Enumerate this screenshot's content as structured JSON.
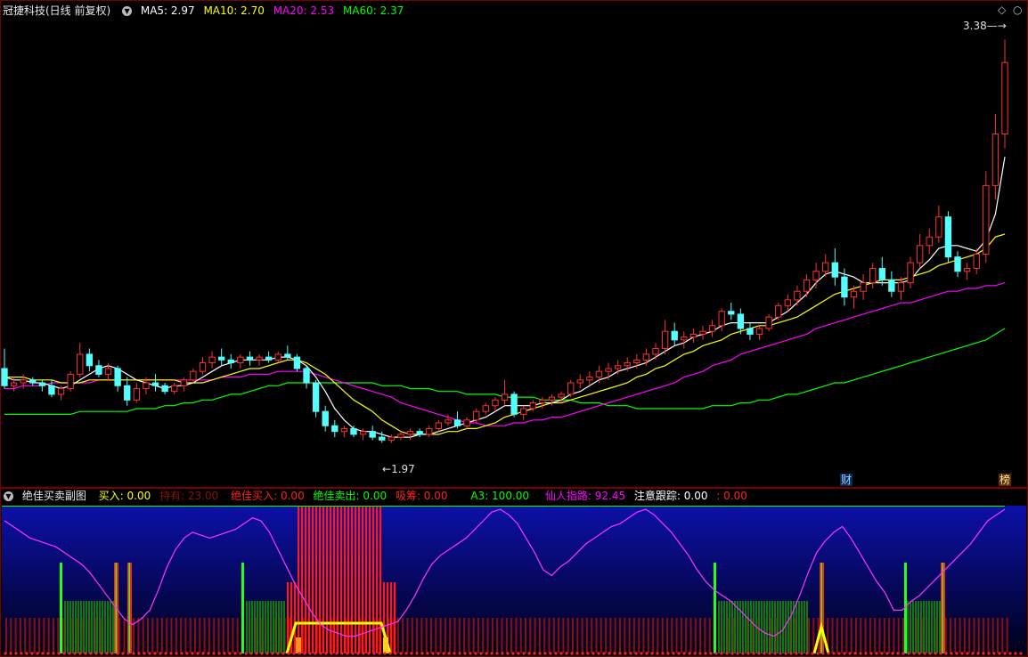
{
  "main": {
    "title": "冠捷科技(日线 前复权)",
    "ma": [
      {
        "label": "MA5: 2.97",
        "color": "#ffffff"
      },
      {
        "label": "MA10: 2.70",
        "color": "#ffff00"
      },
      {
        "label": "MA20: 2.53",
        "color": "#ff00ff"
      },
      {
        "label": "MA60: 2.37",
        "color": "#00ff00"
      }
    ],
    "high_label": "3.38",
    "low_label": "1.97",
    "tag_cai": "财",
    "tag_bang": "榜",
    "diamond": "◇"
  },
  "sub": {
    "title": "绝佳买卖副图",
    "items": [
      {
        "label": "买入: 0.00",
        "color": "#ffff00"
      },
      {
        "label": "持有: 23.00",
        "color": "#8a1010"
      },
      {
        "label": "绝佳买入: 0.00",
        "color": "#ff2020"
      },
      {
        "label": "绝佳卖出: 0.00",
        "color": "#00ff00"
      },
      {
        "label": "吸筹: 0.00",
        "color": "#ff2020"
      },
      {
        "label": "A3: 100.00",
        "color": "#00ff00"
      },
      {
        "label": "仙人指路: 92.45",
        "color": "#ff00ff"
      },
      {
        "label": "注意跟踪: 0.00",
        "color": "#ffffff"
      },
      {
        "label": ": 0.00",
        "color": "#ff2020"
      }
    ]
  },
  "chart_data": [
    {
      "type": "candlestick",
      "title": "冠捷科技(日线 前复权)",
      "ylim": [
        1.9,
        3.45
      ],
      "colors": {
        "up": "#ff3030",
        "down": "#54ffff",
        "ma5": "#ffffff",
        "ma10": "#ffff00",
        "ma20": "#ff00ff",
        "ma60": "#00ff00"
      },
      "candles": [
        [
          2.23,
          2.3,
          2.16,
          2.17
        ],
        [
          2.17,
          2.2,
          2.15,
          2.18
        ],
        [
          2.18,
          2.21,
          2.16,
          2.19
        ],
        [
          2.19,
          2.2,
          2.17,
          2.18
        ],
        [
          2.18,
          2.19,
          2.15,
          2.17
        ],
        [
          2.17,
          2.19,
          2.13,
          2.14
        ],
        [
          2.14,
          2.17,
          2.12,
          2.16
        ],
        [
          2.16,
          2.22,
          2.15,
          2.21
        ],
        [
          2.21,
          2.32,
          2.2,
          2.28
        ],
        [
          2.28,
          2.3,
          2.22,
          2.24
        ],
        [
          2.24,
          2.26,
          2.2,
          2.21
        ],
        [
          2.21,
          2.25,
          2.19,
          2.23
        ],
        [
          2.23,
          2.24,
          2.15,
          2.17
        ],
        [
          2.17,
          2.2,
          2.1,
          2.12
        ],
        [
          2.12,
          2.18,
          2.11,
          2.16
        ],
        [
          2.16,
          2.2,
          2.14,
          2.18
        ],
        [
          2.18,
          2.21,
          2.15,
          2.17
        ],
        [
          2.17,
          2.18,
          2.14,
          2.15
        ],
        [
          2.15,
          2.18,
          2.14,
          2.17
        ],
        [
          2.17,
          2.2,
          2.15,
          2.19
        ],
        [
          2.19,
          2.23,
          2.18,
          2.22
        ],
        [
          2.22,
          2.27,
          2.21,
          2.25
        ],
        [
          2.25,
          2.29,
          2.23,
          2.27
        ],
        [
          2.27,
          2.3,
          2.24,
          2.26
        ],
        [
          2.26,
          2.28,
          2.23,
          2.25
        ],
        [
          2.25,
          2.28,
          2.23,
          2.27
        ],
        [
          2.27,
          2.29,
          2.24,
          2.26
        ],
        [
          2.26,
          2.28,
          2.24,
          2.27
        ],
        [
          2.27,
          2.29,
          2.25,
          2.26
        ],
        [
          2.26,
          2.29,
          2.25,
          2.28
        ],
        [
          2.28,
          2.31,
          2.26,
          2.27
        ],
        [
          2.27,
          2.28,
          2.22,
          2.23
        ],
        [
          2.23,
          2.24,
          2.16,
          2.18
        ],
        [
          2.18,
          2.19,
          2.06,
          2.08
        ],
        [
          2.08,
          2.1,
          2.01,
          2.03
        ],
        [
          2.03,
          2.05,
          1.99,
          2.01
        ],
        [
          2.01,
          2.03,
          1.99,
          2.02
        ],
        [
          2.02,
          2.03,
          1.99,
          2.0
        ],
        [
          2.0,
          2.02,
          1.98,
          2.01
        ],
        [
          2.01,
          2.03,
          1.98,
          1.99
        ],
        [
          1.99,
          2.01,
          1.97,
          1.98
        ],
        [
          1.98,
          2.0,
          1.97,
          1.99
        ],
        [
          1.99,
          2.01,
          1.98,
          2.0
        ],
        [
          2.0,
          2.02,
          1.98,
          2.01
        ],
        [
          2.01,
          2.02,
          1.99,
          2.0
        ],
        [
          2.0,
          2.03,
          1.99,
          2.02
        ],
        [
          2.02,
          2.05,
          2.01,
          2.04
        ],
        [
          2.04,
          2.07,
          2.03,
          2.05
        ],
        [
          2.05,
          2.08,
          2.02,
          2.03
        ],
        [
          2.03,
          2.06,
          2.02,
          2.05
        ],
        [
          2.05,
          2.09,
          2.04,
          2.08
        ],
        [
          2.08,
          2.11,
          2.07,
          2.1
        ],
        [
          2.1,
          2.13,
          2.08,
          2.12
        ],
        [
          2.12,
          2.19,
          2.1,
          2.14
        ],
        [
          2.14,
          2.15,
          2.06,
          2.07
        ],
        [
          2.07,
          2.1,
          2.05,
          2.09
        ],
        [
          2.09,
          2.12,
          2.08,
          2.11
        ],
        [
          2.11,
          2.13,
          2.09,
          2.12
        ],
        [
          2.12,
          2.14,
          2.1,
          2.13
        ],
        [
          2.13,
          2.15,
          2.11,
          2.14
        ],
        [
          2.14,
          2.19,
          2.13,
          2.18
        ],
        [
          2.18,
          2.21,
          2.16,
          2.19
        ],
        [
          2.19,
          2.22,
          2.17,
          2.2
        ],
        [
          2.2,
          2.24,
          2.18,
          2.22
        ],
        [
          2.22,
          2.25,
          2.19,
          2.23
        ],
        [
          2.23,
          2.26,
          2.21,
          2.24
        ],
        [
          2.24,
          2.27,
          2.22,
          2.25
        ],
        [
          2.25,
          2.28,
          2.23,
          2.26
        ],
        [
          2.26,
          2.3,
          2.24,
          2.28
        ],
        [
          2.28,
          2.32,
          2.26,
          2.3
        ],
        [
          2.3,
          2.4,
          2.28,
          2.36
        ],
        [
          2.36,
          2.39,
          2.31,
          2.33
        ],
        [
          2.33,
          2.36,
          2.3,
          2.34
        ],
        [
          2.34,
          2.37,
          2.32,
          2.35
        ],
        [
          2.35,
          2.38,
          2.33,
          2.36
        ],
        [
          2.36,
          2.4,
          2.34,
          2.38
        ],
        [
          2.38,
          2.44,
          2.36,
          2.43
        ],
        [
          2.43,
          2.46,
          2.4,
          2.42
        ],
        [
          2.42,
          2.44,
          2.35,
          2.37
        ],
        [
          2.37,
          2.39,
          2.33,
          2.35
        ],
        [
          2.35,
          2.38,
          2.33,
          2.37
        ],
        [
          2.37,
          2.42,
          2.36,
          2.41
        ],
        [
          2.41,
          2.46,
          2.4,
          2.45
        ],
        [
          2.45,
          2.49,
          2.43,
          2.47
        ],
        [
          2.47,
          2.52,
          2.45,
          2.5
        ],
        [
          2.5,
          2.56,
          2.48,
          2.54
        ],
        [
          2.54,
          2.6,
          2.51,
          2.57
        ],
        [
          2.57,
          2.63,
          2.55,
          2.6
        ],
        [
          2.6,
          2.65,
          2.52,
          2.55
        ],
        [
          2.55,
          2.58,
          2.45,
          2.48
        ],
        [
          2.48,
          2.52,
          2.44,
          2.5
        ],
        [
          2.5,
          2.56,
          2.47,
          2.53
        ],
        [
          2.53,
          2.6,
          2.51,
          2.58
        ],
        [
          2.58,
          2.62,
          2.52,
          2.54
        ],
        [
          2.54,
          2.57,
          2.48,
          2.5
        ],
        [
          2.5,
          2.55,
          2.47,
          2.53
        ],
        [
          2.53,
          2.62,
          2.51,
          2.6
        ],
        [
          2.6,
          2.7,
          2.58,
          2.66
        ],
        [
          2.66,
          2.72,
          2.63,
          2.69
        ],
        [
          2.69,
          2.8,
          2.67,
          2.76
        ],
        [
          2.76,
          2.78,
          2.6,
          2.62
        ],
        [
          2.62,
          2.64,
          2.55,
          2.57
        ],
        [
          2.57,
          2.6,
          2.54,
          2.58
        ],
        [
          2.58,
          2.65,
          2.56,
          2.63
        ],
        [
          2.63,
          2.92,
          2.6,
          2.87
        ],
        [
          2.87,
          3.12,
          2.82,
          3.05
        ],
        [
          3.05,
          3.38,
          3.0,
          3.3
        ]
      ],
      "ma5": [
        2.2,
        2.19,
        2.19,
        2.18,
        2.18,
        2.17,
        2.16,
        2.17,
        2.19,
        2.21,
        2.23,
        2.24,
        2.23,
        2.21,
        2.19,
        2.18,
        2.17,
        2.16,
        2.17,
        2.17,
        2.18,
        2.2,
        2.22,
        2.24,
        2.25,
        2.26,
        2.26,
        2.26,
        2.26,
        2.27,
        2.27,
        2.26,
        2.24,
        2.2,
        2.15,
        2.09,
        2.05,
        2.02,
        2.01,
        2.01,
        2.0,
        1.99,
        1.99,
        1.99,
        2.0,
        2.0,
        2.01,
        2.02,
        2.03,
        2.04,
        2.05,
        2.06,
        2.08,
        2.1,
        2.1,
        2.1,
        2.1,
        2.11,
        2.11,
        2.12,
        2.14,
        2.15,
        2.17,
        2.19,
        2.2,
        2.22,
        2.23,
        2.24,
        2.25,
        2.27,
        2.29,
        2.31,
        2.32,
        2.34,
        2.35,
        2.36,
        2.38,
        2.39,
        2.39,
        2.39,
        2.39,
        2.39,
        2.41,
        2.43,
        2.46,
        2.49,
        2.53,
        2.56,
        2.57,
        2.56,
        2.55,
        2.53,
        2.53,
        2.53,
        2.53,
        2.53,
        2.54,
        2.58,
        2.61,
        2.65,
        2.66,
        2.66,
        2.65,
        2.64,
        2.68,
        2.77,
        2.97
      ],
      "ma10": [
        2.2,
        2.2,
        2.2,
        2.19,
        2.19,
        2.19,
        2.18,
        2.18,
        2.18,
        2.19,
        2.19,
        2.19,
        2.19,
        2.19,
        2.19,
        2.19,
        2.19,
        2.19,
        2.19,
        2.18,
        2.18,
        2.18,
        2.19,
        2.2,
        2.21,
        2.22,
        2.23,
        2.23,
        2.24,
        2.25,
        2.26,
        2.26,
        2.25,
        2.23,
        2.21,
        2.18,
        2.15,
        2.12,
        2.1,
        2.08,
        2.05,
        2.03,
        2.01,
        2.0,
        2.0,
        2.0,
        2.0,
        2.01,
        2.01,
        2.02,
        2.02,
        2.03,
        2.04,
        2.06,
        2.07,
        2.08,
        2.09,
        2.1,
        2.11,
        2.11,
        2.12,
        2.13,
        2.14,
        2.15,
        2.16,
        2.17,
        2.18,
        2.2,
        2.21,
        2.23,
        2.24,
        2.26,
        2.28,
        2.29,
        2.31,
        2.32,
        2.33,
        2.35,
        2.36,
        2.37,
        2.38,
        2.38,
        2.39,
        2.4,
        2.41,
        2.43,
        2.45,
        2.47,
        2.49,
        2.5,
        2.51,
        2.52,
        2.53,
        2.54,
        2.54,
        2.54,
        2.55,
        2.56,
        2.57,
        2.59,
        2.6,
        2.61,
        2.62,
        2.63,
        2.65,
        2.69,
        2.7
      ],
      "ma20": [
        2.16,
        2.16,
        2.17,
        2.17,
        2.17,
        2.18,
        2.18,
        2.18,
        2.18,
        2.18,
        2.19,
        2.19,
        2.19,
        2.19,
        2.19,
        2.19,
        2.19,
        2.19,
        2.19,
        2.19,
        2.19,
        2.19,
        2.19,
        2.2,
        2.2,
        2.2,
        2.21,
        2.21,
        2.21,
        2.22,
        2.22,
        2.22,
        2.22,
        2.21,
        2.2,
        2.19,
        2.18,
        2.17,
        2.16,
        2.15,
        2.14,
        2.13,
        2.11,
        2.1,
        2.09,
        2.08,
        2.07,
        2.06,
        2.05,
        2.04,
        2.04,
        2.03,
        2.03,
        2.03,
        2.04,
        2.04,
        2.05,
        2.05,
        2.06,
        2.06,
        2.07,
        2.08,
        2.09,
        2.1,
        2.11,
        2.12,
        2.13,
        2.14,
        2.15,
        2.16,
        2.17,
        2.18,
        2.2,
        2.21,
        2.22,
        2.24,
        2.25,
        2.26,
        2.28,
        2.29,
        2.3,
        2.31,
        2.32,
        2.33,
        2.34,
        2.35,
        2.37,
        2.38,
        2.39,
        2.4,
        2.41,
        2.42,
        2.43,
        2.44,
        2.45,
        2.46,
        2.46,
        2.47,
        2.48,
        2.49,
        2.5,
        2.5,
        2.51,
        2.51,
        2.52,
        2.52,
        2.53
      ],
      "ma60": [
        2.07,
        2.07,
        2.07,
        2.07,
        2.07,
        2.07,
        2.07,
        2.07,
        2.08,
        2.08,
        2.08,
        2.08,
        2.08,
        2.08,
        2.09,
        2.09,
        2.09,
        2.1,
        2.1,
        2.11,
        2.11,
        2.12,
        2.12,
        2.13,
        2.14,
        2.14,
        2.15,
        2.16,
        2.17,
        2.17,
        2.18,
        2.18,
        2.18,
        2.18,
        2.18,
        2.18,
        2.18,
        2.18,
        2.18,
        2.18,
        2.17,
        2.17,
        2.17,
        2.16,
        2.16,
        2.16,
        2.15,
        2.15,
        2.15,
        2.14,
        2.14,
        2.14,
        2.14,
        2.13,
        2.13,
        2.13,
        2.13,
        2.12,
        2.12,
        2.12,
        2.12,
        2.11,
        2.11,
        2.11,
        2.1,
        2.1,
        2.1,
        2.09,
        2.09,
        2.09,
        2.09,
        2.09,
        2.09,
        2.09,
        2.09,
        2.1,
        2.1,
        2.1,
        2.11,
        2.11,
        2.12,
        2.12,
        2.13,
        2.14,
        2.14,
        2.15,
        2.16,
        2.17,
        2.18,
        2.18,
        2.19,
        2.2,
        2.21,
        2.22,
        2.23,
        2.24,
        2.25,
        2.26,
        2.27,
        2.28,
        2.29,
        2.3,
        2.31,
        2.32,
        2.33,
        2.35,
        2.37
      ]
    },
    {
      "type": "indicator",
      "title": "绝佳买卖副图",
      "ylim": [
        0,
        100
      ],
      "xianren": [
        92,
        88,
        84,
        80,
        78,
        76,
        74,
        70,
        66,
        62,
        56,
        48,
        40,
        32,
        24,
        20,
        24,
        30,
        44,
        60,
        72,
        80,
        84,
        82,
        80,
        82,
        84,
        86,
        90,
        94,
        92,
        84,
        72,
        60,
        48,
        38,
        28,
        20,
        16,
        14,
        12,
        12,
        14,
        16,
        18,
        20,
        22,
        30,
        40,
        52,
        62,
        68,
        72,
        76,
        80,
        86,
        92,
        98,
        100,
        96,
        90,
        80,
        70,
        58,
        54,
        60,
        64,
        70,
        76,
        80,
        84,
        88,
        90,
        94,
        98,
        100,
        96,
        90,
        84,
        76,
        68,
        58,
        50,
        44,
        40,
        36,
        30,
        24,
        18,
        14,
        12,
        16,
        26,
        40,
        56,
        70,
        78,
        84,
        88,
        80,
        70,
        60,
        50,
        42,
        30,
        30,
        36,
        40,
        46,
        52,
        58,
        64,
        70,
        76,
        84,
        92,
        96,
        100
      ]
    }
  ]
}
